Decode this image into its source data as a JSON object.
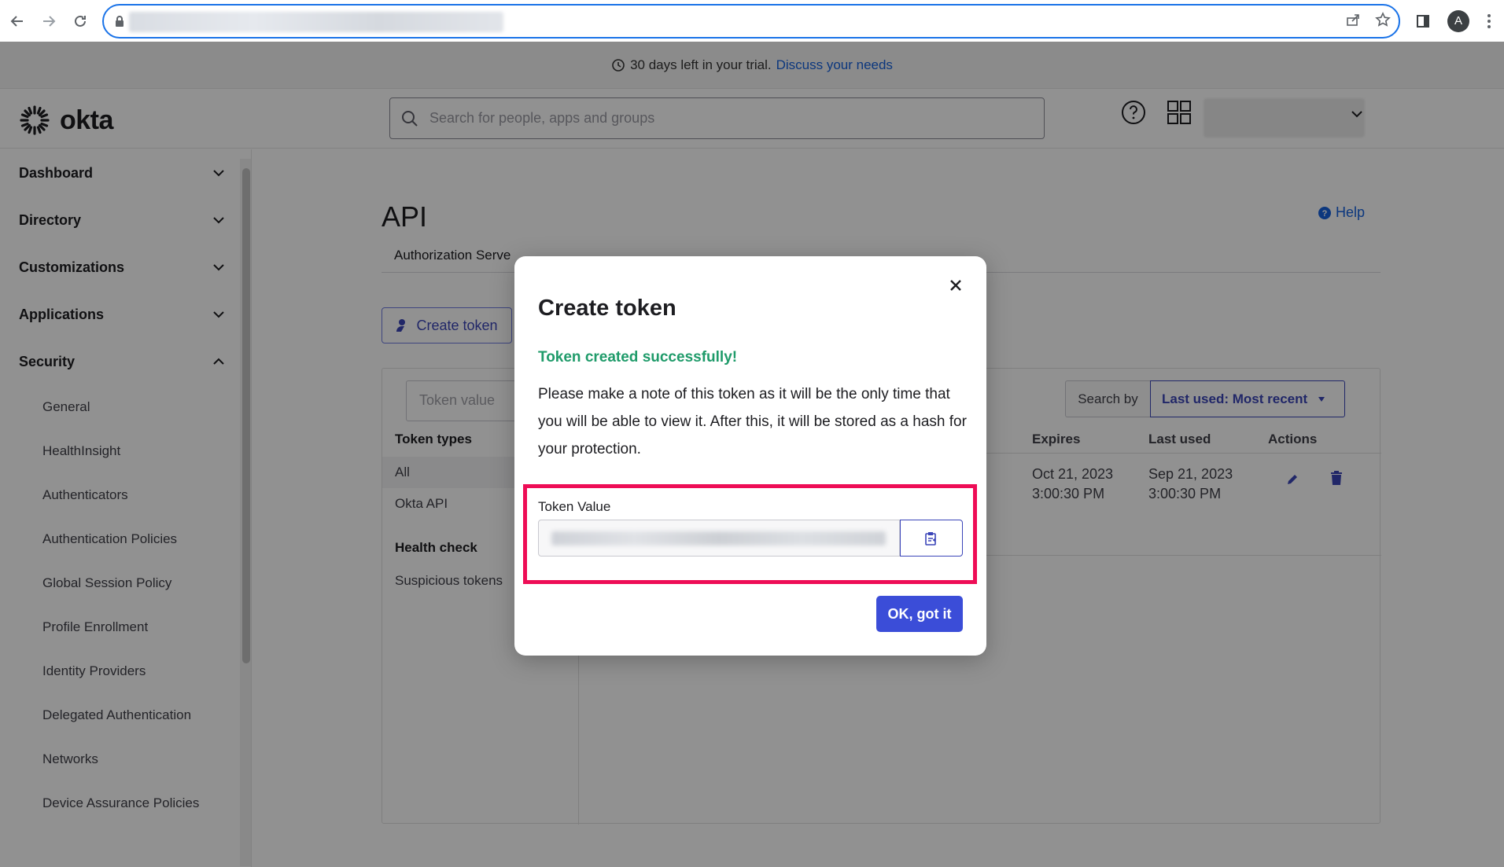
{
  "browser": {
    "avatar_letter": "A",
    "accent": "#1a73e8"
  },
  "trial": {
    "text": "30 days left in your trial.",
    "link": "Discuss your needs"
  },
  "header": {
    "logo": "okta",
    "search_placeholder": "Search for people, apps and groups"
  },
  "sidebar": {
    "sections": [
      {
        "label": "Dashboard",
        "icon": "chevron-down-icon"
      },
      {
        "label": "Directory",
        "icon": "chevron-down-icon"
      },
      {
        "label": "Customizations",
        "icon": "chevron-down-icon"
      },
      {
        "label": "Applications",
        "icon": "chevron-down-icon"
      },
      {
        "label": "Security",
        "icon": "chevron-up-icon"
      }
    ],
    "security_items": [
      "General",
      "HealthInsight",
      "Authenticators",
      "Authentication Policies",
      "Global Session Policy",
      "Profile Enrollment",
      "Identity Providers",
      "Delegated Authentication",
      "Networks",
      "Device Assurance Policies"
    ]
  },
  "main": {
    "title": "API",
    "help": "Help",
    "tab": "Authorization Serve",
    "create_button": "Create token",
    "token_filter_placeholder": "Token value",
    "search_by_label": "Search by",
    "search_by_value": "Last used: Most recent",
    "filters": {
      "token_types_header": "Token types",
      "token_types": [
        "All",
        "Okta API"
      ],
      "health_header": "Health check",
      "health_items": [
        "Suspicious tokens"
      ]
    },
    "table": {
      "headers": {
        "expires": "Expires",
        "last_used": "Last used",
        "actions": "Actions"
      },
      "row": {
        "expires_date": "Oct 21, 2023",
        "expires_time": "3:00:30 PM",
        "last_used_date": "Sep 21, 2023",
        "last_used_time": "3:00:30 PM"
      }
    }
  },
  "modal": {
    "title": "Create token",
    "success": "Token created successfully!",
    "body": "Please make a note of this token as it will be the only time that you will be able to view it. After this, it will be stored as a hash for your protection.",
    "field_label": "Token Value",
    "ok_button": "OK, got it",
    "success_color": "#1f9b6a",
    "primary_color": "#3b4dd8",
    "highlight_color": "#ee0d56"
  }
}
